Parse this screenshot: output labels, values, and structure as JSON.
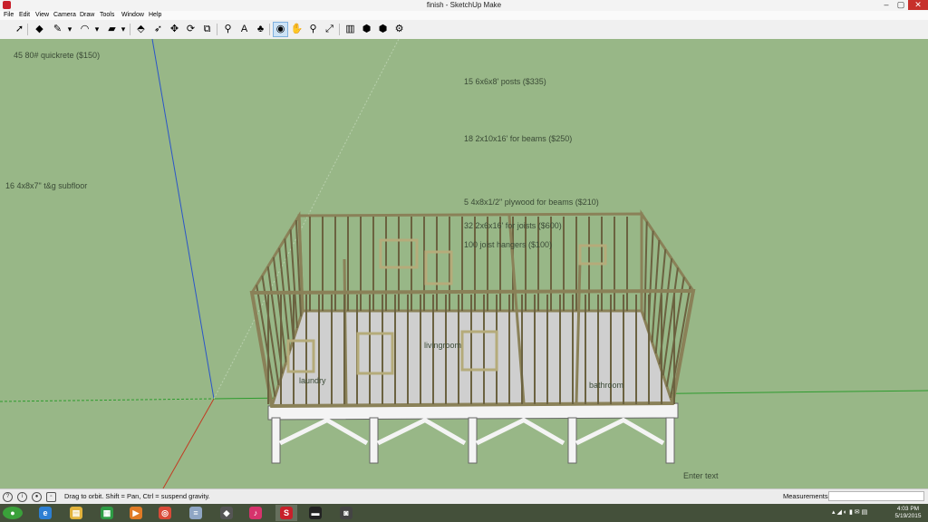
{
  "window": {
    "title": "finish - SketchUp Make",
    "app_icon": "sketchup-icon",
    "controls": {
      "minimize": "–",
      "maximize": "▢",
      "close": "✕"
    }
  },
  "menu": [
    "File",
    "Edit",
    "View",
    "Camera",
    "Draw",
    "Tools",
    "Window",
    "Help"
  ],
  "toolbar": {
    "tools": [
      {
        "name": "select-tool",
        "glyph": "➚"
      },
      {
        "name": "eraser-tool",
        "glyph": "◆"
      },
      {
        "name": "line-tool",
        "glyph": "✎"
      },
      {
        "name": "line-dropdown",
        "glyph": "▾"
      },
      {
        "name": "arc-tool",
        "glyph": "◠"
      },
      {
        "name": "arc-dropdown",
        "glyph": "▾"
      },
      {
        "name": "rectangle-tool",
        "glyph": "▰"
      },
      {
        "name": "rectangle-dropdown",
        "glyph": "▾"
      },
      {
        "name": "push-pull-tool",
        "glyph": "⬘"
      },
      {
        "name": "follow-me-tool",
        "glyph": "➶"
      },
      {
        "name": "move-tool",
        "glyph": "✥"
      },
      {
        "name": "rotate-tool",
        "glyph": "⟳"
      },
      {
        "name": "scale-tool",
        "glyph": "⧉"
      },
      {
        "name": "tape-measure-tool",
        "glyph": "⚲"
      },
      {
        "name": "text-tool",
        "glyph": "A"
      },
      {
        "name": "paint-bucket-tool",
        "glyph": "♣"
      },
      {
        "name": "orbit-tool",
        "glyph": "◉",
        "active": true
      },
      {
        "name": "pan-tool",
        "glyph": "✋"
      },
      {
        "name": "zoom-tool",
        "glyph": "⚲"
      },
      {
        "name": "zoom-extents-tool",
        "glyph": "⤢"
      },
      {
        "name": "warehouse-tool",
        "glyph": "▥"
      },
      {
        "name": "extension-warehouse-tool",
        "glyph": "⬢"
      },
      {
        "name": "send-to-layout-tool",
        "glyph": "⬢"
      },
      {
        "name": "extension-manager-tool",
        "glyph": "⚙"
      }
    ]
  },
  "viewport": {
    "background": "#98b787",
    "notes": [
      "45 80# quickrete ($150)",
      "15 6x6x8' posts ($335)",
      "18 2x10x16' for beams ($250)",
      "16 4x8x7\" t&g subfloor",
      "5 4x8x1/2\" plywood for beams ($210)",
      "32 2x6x16' for joists ($600)",
      "100 joist hangers ($100)"
    ],
    "room_labels": [
      "livingroom",
      "bathroom",
      "laundry"
    ],
    "enter_text": "Enter text",
    "axis_colors": {
      "red": "#c23b22",
      "green": "#2e9b2e",
      "blue": "#2a55c9"
    }
  },
  "status": {
    "hint": "Drag to orbit. Shift = Pan, Ctrl = suspend gravity.",
    "measurements_label": "Measurements",
    "measurements_value": ""
  },
  "taskbar": {
    "apps": [
      {
        "name": "start-button",
        "glyph": "●",
        "color": "#3aa13a"
      },
      {
        "name": "ie-icon",
        "glyph": "e",
        "color": "#2d7fd3"
      },
      {
        "name": "file-explorer-icon",
        "glyph": "▤",
        "color": "#e2b33c"
      },
      {
        "name": "store-icon",
        "glyph": "▦",
        "color": "#2e9b44"
      },
      {
        "name": "media-player-icon",
        "glyph": "▶",
        "color": "#e07a25"
      },
      {
        "name": "chrome-icon",
        "glyph": "◎",
        "color": "#d94a38"
      },
      {
        "name": "notepad-icon",
        "glyph": "≡",
        "color": "#8fa6c4"
      },
      {
        "name": "app-icon",
        "glyph": "◆",
        "color": "#555555"
      },
      {
        "name": "itunes-icon",
        "glyph": "♪",
        "color": "#d6336c"
      },
      {
        "name": "sketchup-taskbar-icon",
        "glyph": "S",
        "color": "#c8202a",
        "active": true
      },
      {
        "name": "terminal-icon",
        "glyph": "▬",
        "color": "#222222"
      },
      {
        "name": "camera-icon",
        "glyph": "◙",
        "color": "#444444"
      }
    ],
    "clock": {
      "time": "4:03 PM",
      "date": "5/19/2015"
    }
  }
}
